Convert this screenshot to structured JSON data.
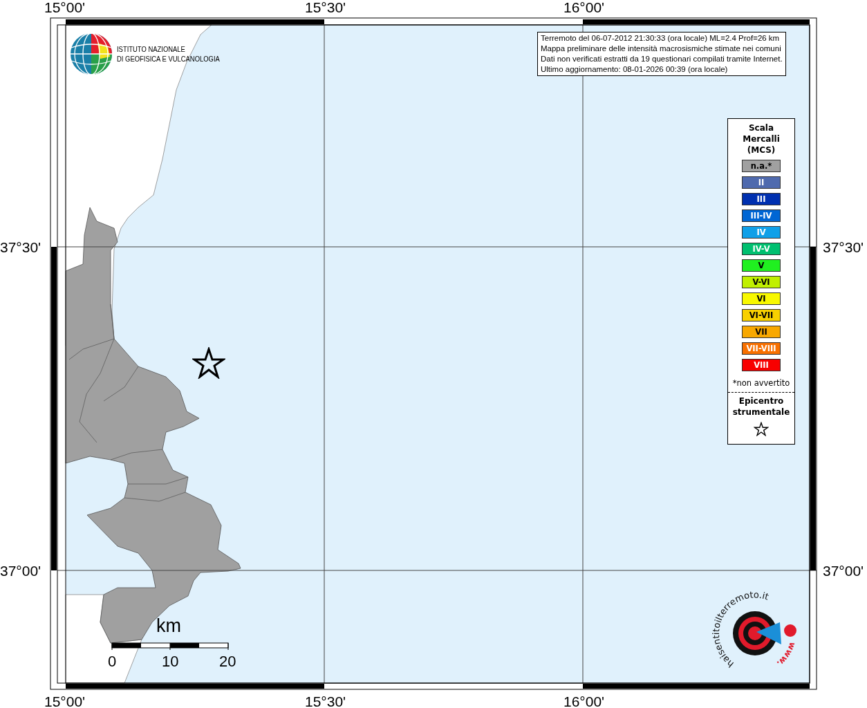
{
  "info_box": {
    "lines": [
      "Terremoto del 06-07-2012 21:30:33 (ora locale) ML=2.4 Prof=26 km",
      "Mappa preliminare delle intensità macrosismiche stimate nei comuni",
      "Dati non verificati estratti da 19 questionari compilati tramite Internet.",
      "Ultimo aggiornamento: 08-01-2026 00:39 (ora locale)"
    ]
  },
  "ingv_logo": {
    "lines": [
      "ISTITUTO NAZIONALE",
      "DI GEOFISICA E VULCANOLOGIA"
    ]
  },
  "axes": {
    "top": [
      "15°00'",
      "15°30'",
      "16°00'"
    ],
    "bottom": [
      "15°00'",
      "15°30'",
      "16°00'"
    ],
    "left": [
      "37°30'",
      "37°00'"
    ],
    "right": [
      "37°30'",
      "37°00'"
    ]
  },
  "legend": {
    "title": "Scala Mercalli (MCS)",
    "items": [
      {
        "label": "n.a.*",
        "color": "#a0a0a0"
      },
      {
        "label": "II",
        "color": "#4f6aae"
      },
      {
        "label": "III",
        "color": "#0030b0"
      },
      {
        "label": "III-IV",
        "color": "#0066d4"
      },
      {
        "label": "IV",
        "color": "#10a0e8"
      },
      {
        "label": "IV-V",
        "color": "#00c070"
      },
      {
        "label": "V",
        "color": "#20f020"
      },
      {
        "label": "V-VI",
        "color": "#c0f000"
      },
      {
        "label": "VI",
        "color": "#f8f800"
      },
      {
        "label": "VI-VII",
        "color": "#f8d000"
      },
      {
        "label": "VII",
        "color": "#f8a800"
      },
      {
        "label": "VII-VIII",
        "color": "#f87000"
      },
      {
        "label": "VIII",
        "color": "#f80000"
      }
    ],
    "note": "*non avvertito",
    "epicentre_label": "Epicentro strumentale"
  },
  "scale_bar": {
    "unit": "km",
    "ticks": [
      "0",
      "10",
      "20"
    ]
  },
  "hst_logo": {
    "arc_text": "haisentitoilterremoto.it",
    "side_text": "www."
  }
}
